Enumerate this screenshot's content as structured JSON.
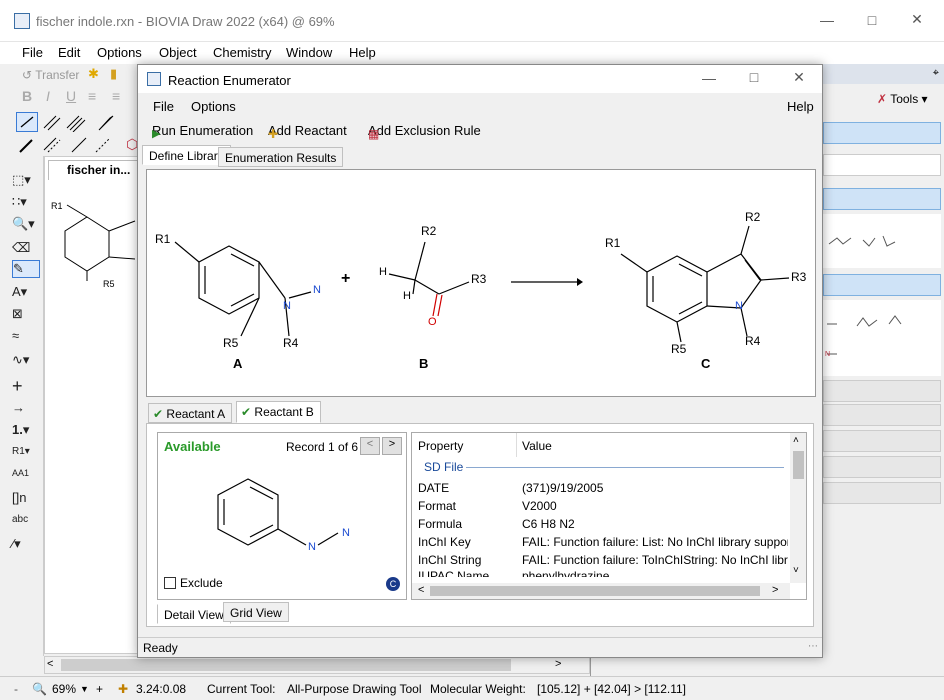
{
  "main_window": {
    "title": "fischer indole.rxn - BIOVIA Draw 2022 (x64)  @ 69%",
    "menu": [
      "File",
      "Edit",
      "Options",
      "Object",
      "Chemistry",
      "Window",
      "Help"
    ],
    "toolbar": {
      "transfer_label": "Transfer"
    },
    "doc_tab": "fischer in...",
    "right_panel": {
      "tools_label": "Tools"
    },
    "status": {
      "zoom": "69%",
      "coords": "3.24:0.08",
      "current_tool": "Current Tool:",
      "tool_name": "All-Purpose Drawing Tool",
      "mw_label": "Molecular Weight:",
      "mw_value": "[105.12] + [42.04] > [112.11]"
    }
  },
  "dialog": {
    "title": "Reaction Enumerator",
    "menu": {
      "file": "File",
      "options": "Options",
      "help": "Help"
    },
    "toolbar": {
      "run": "Run Enumeration",
      "add_reactant": "Add Reactant",
      "add_exclusion": "Add Exclusion Rule"
    },
    "tabs": {
      "define": "Define Library",
      "results": "Enumeration Results"
    },
    "reaction": {
      "labels": {
        "a": "A",
        "b": "B",
        "c": "C"
      },
      "groups": {
        "r1": "R1",
        "r2": "R2",
        "r3": "R3",
        "r4": "R4",
        "r5": "R5",
        "n": "N",
        "h": "H",
        "o": "O"
      },
      "plus": "+"
    },
    "reactant_tabs": {
      "a": "Reactant A",
      "b": "Reactant B"
    },
    "record": {
      "available": "Available",
      "record_text": "Record 1 of 6",
      "prev": "<",
      "next": ">",
      "exclude": "Exclude"
    },
    "views": {
      "detail": "Detail View",
      "grid": "Grid View"
    },
    "properties": {
      "header_property": "Property",
      "header_value": "Value",
      "section": "SD File",
      "rows": [
        {
          "name": "DATE",
          "value": "(371)9/19/2005"
        },
        {
          "name": "Format",
          "value": "V2000"
        },
        {
          "name": "Formula",
          "value": "C6 H8 N2"
        },
        {
          "name": "InChI Key",
          "value": "FAIL: Function failure: List: No InChI library support av..."
        },
        {
          "name": "InChI String",
          "value": "FAIL: Function failure: ToInChIString: No InChI library s..."
        },
        {
          "name": "IUPAC Name",
          "value": "phenylhydrazine"
        }
      ]
    },
    "status": "Ready"
  }
}
